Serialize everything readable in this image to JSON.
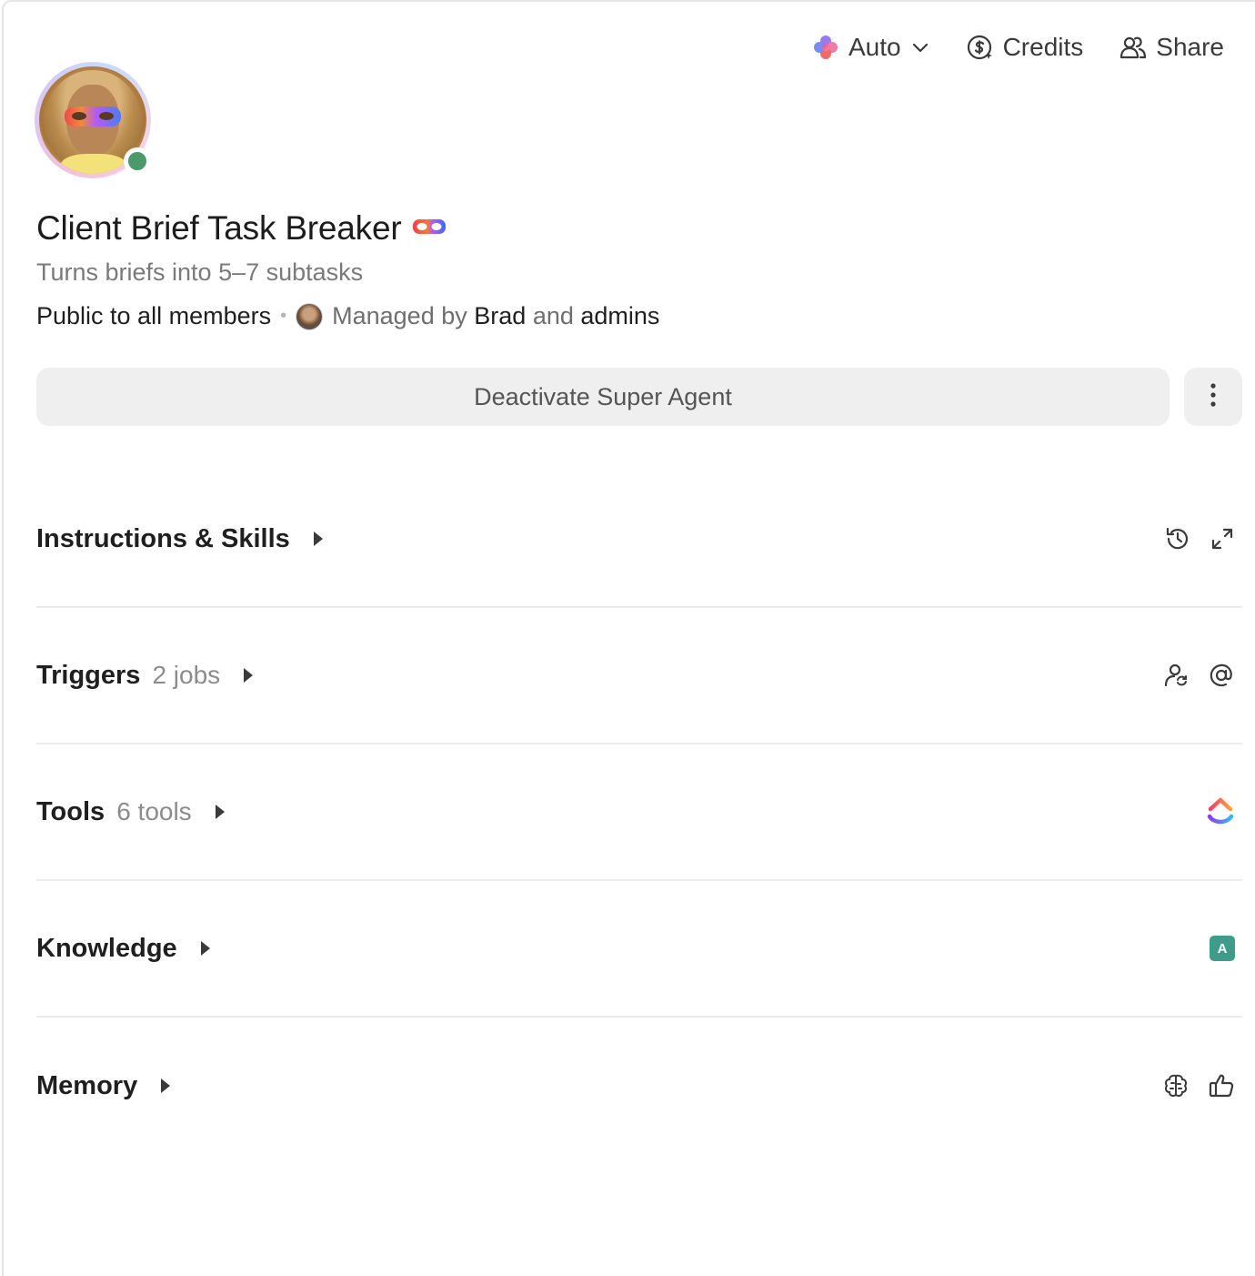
{
  "topbar": {
    "model_label": "Auto",
    "credits_label": "Credits",
    "share_label": "Share"
  },
  "agent": {
    "name": "Client Brief Task Breaker",
    "description": "Turns briefs into 5–7 subtasks",
    "visibility": "Public to all members",
    "managed_by_prefix": "Managed by",
    "manager": "Brad",
    "and": "and",
    "admins": "admins",
    "status_color": "#4a9a6a"
  },
  "actions": {
    "deactivate_label": "Deactivate Super Agent"
  },
  "sections": [
    {
      "title": "Instructions & Skills",
      "count": "",
      "icons": [
        "history-icon",
        "expand-icon"
      ]
    },
    {
      "title": "Triggers",
      "count": "2 jobs",
      "icons": [
        "user-sync-icon",
        "at-mention-icon"
      ]
    },
    {
      "title": "Tools",
      "count": "6 tools",
      "icons": [
        "clickup-logo-icon"
      ]
    },
    {
      "title": "Knowledge",
      "count": "",
      "icons": [
        "knowledge-source-badge"
      ],
      "badge_text": "A"
    },
    {
      "title": "Memory",
      "count": "",
      "icons": [
        "brain-icon",
        "thumbs-up-icon"
      ]
    }
  ],
  "colors": {
    "knowledge_badge": "#3f9b8a",
    "button_bg": "#efefef"
  }
}
